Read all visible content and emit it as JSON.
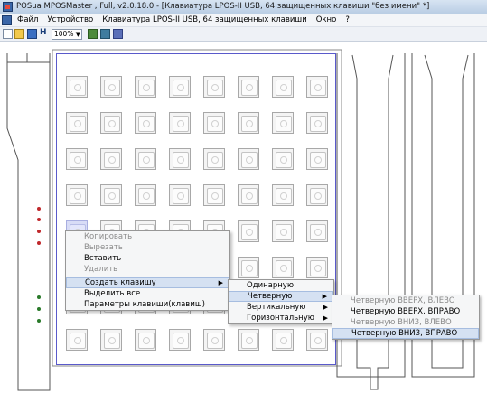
{
  "window": {
    "title": "POSua MPOSMaster , Full, v2.0.18.0 - [Клавиатура LPOS-II USB, 64 защищенных клавиши \"без имени\" *]"
  },
  "menubar": {
    "items": [
      "Файл",
      "Устройство",
      "Клавиатура LPOS-II USB, 64 защищенных клавиши",
      "Окно",
      "?"
    ]
  },
  "toolbar": {
    "zoom_value": "100%",
    "h_label": "H"
  },
  "context_menu": {
    "items": [
      {
        "label": "Копировать",
        "enabled": false
      },
      {
        "label": "Вырезать",
        "enabled": false
      },
      {
        "label": "Вставить",
        "enabled": true
      },
      {
        "label": "Удалить",
        "enabled": false
      },
      {
        "label": "Создать клавишу",
        "enabled": true,
        "submenu": true,
        "highlighted": true
      },
      {
        "label": "Выделить все",
        "enabled": true
      },
      {
        "label": "Параметры клавиши(клавиш)",
        "enabled": true
      }
    ]
  },
  "submenu_create": {
    "items": [
      {
        "label": "Одинарную",
        "submenu": false
      },
      {
        "label": "Четверную",
        "submenu": true,
        "highlighted": true
      },
      {
        "label": "Вертикальную",
        "submenu": true
      },
      {
        "label": "Горизонтальную",
        "submenu": true
      }
    ]
  },
  "submenu_quad": {
    "items": [
      {
        "label": "Четверную ВВЕРХ, ВЛЕВО",
        "enabled": false
      },
      {
        "label": "Четверную ВВЕРХ, ВПРАВО",
        "enabled": true
      },
      {
        "label": "Четверную ВНИЗ, ВЛЕВО",
        "enabled": false
      },
      {
        "label": "Четверную ВНИЗ, ВПРАВО",
        "enabled": true,
        "highlighted": true
      }
    ]
  },
  "keyboard": {
    "rows": 8,
    "cols": 8,
    "selected_key": {
      "row": 4,
      "col": 0
    }
  },
  "colors": {
    "grid_border": "#5a5acb",
    "led_red": "#c0282c",
    "led_green": "#2a7a2a",
    "menu_highlight": "#d5e1f2"
  }
}
